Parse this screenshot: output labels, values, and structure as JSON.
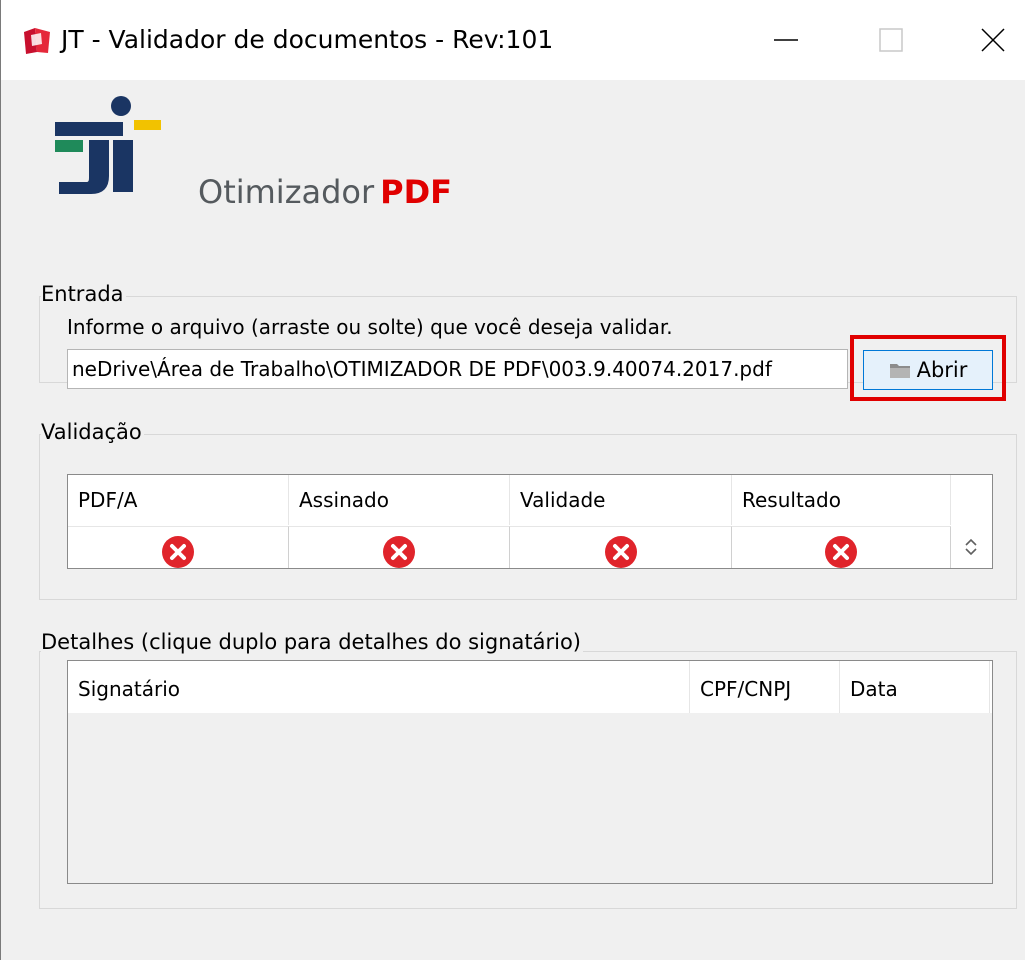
{
  "window": {
    "title": "JT - Validador de documentos - Rev:101"
  },
  "brand": {
    "product_prefix": "Otimizador",
    "product_suffix": "PDF",
    "colors": {
      "accent_red": "#e00000",
      "logo_blue": "#1a3563",
      "logo_green": "#1f8a5a",
      "logo_yellow": "#f2c200"
    }
  },
  "entrada": {
    "label": "Entrada",
    "hint": "Informe o arquivo (arraste ou solte) que você deseja validar.",
    "file_path": "neDrive\\Área de Trabalho\\OTIMIZADOR DE PDF\\003.9.40074.2017.pdf",
    "open_button_label": "Abrir",
    "open_button_icon": "folder-icon"
  },
  "validacao": {
    "label": "Validação",
    "columns": [
      "PDF/A",
      "Assinado",
      "Validade",
      "Resultado"
    ],
    "status_icon": "error-x-icon"
  },
  "detalhes": {
    "label": "Detalhes (clique duplo para detalhes do signatário)",
    "columns": [
      "Signatário",
      "CPF/CNPJ",
      "Data"
    ]
  }
}
